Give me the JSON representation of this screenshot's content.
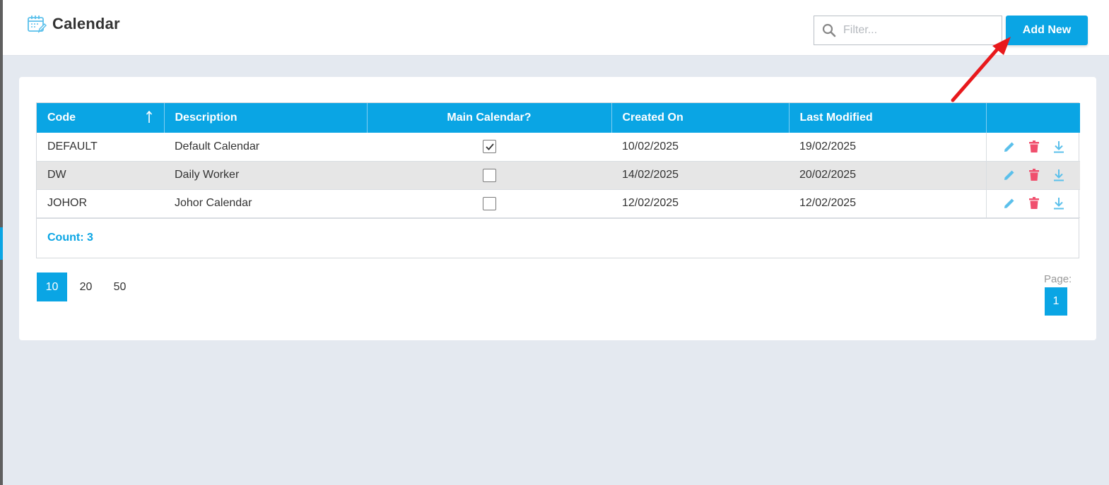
{
  "header": {
    "title": "Calendar",
    "title_icon": "calendar-edit-icon",
    "filter_placeholder": "Filter...",
    "filter_value": "",
    "add_button": "Add New"
  },
  "table": {
    "columns": [
      "Code",
      "Description",
      "Main Calendar?",
      "Created On",
      "Last Modified",
      ""
    ],
    "sort": {
      "column": "Code",
      "direction": "ascending"
    },
    "rows": [
      {
        "code": "DEFAULT",
        "description": "Default Calendar",
        "main": true,
        "created": "10/02/2025",
        "modified": "19/02/2025"
      },
      {
        "code": "DW",
        "description": "Daily Worker",
        "main": false,
        "created": "14/02/2025",
        "modified": "20/02/2025"
      },
      {
        "code": "JOHOR",
        "description": "Johor Calendar",
        "main": false,
        "created": "12/02/2025",
        "modified": "12/02/2025"
      }
    ],
    "row_actions": [
      "edit-icon",
      "delete-icon",
      "download-icon"
    ],
    "count": "Count: 3"
  },
  "pager": {
    "page_sizes": [
      "10",
      "20",
      "50"
    ],
    "selected_page_size": "10",
    "page_label": "Page:",
    "current_page": "1"
  },
  "colors": {
    "accent": "#0aa5e4",
    "delete": "#f0506e",
    "action_icon": "#5bc0eb",
    "arrow": "#e8191c"
  }
}
